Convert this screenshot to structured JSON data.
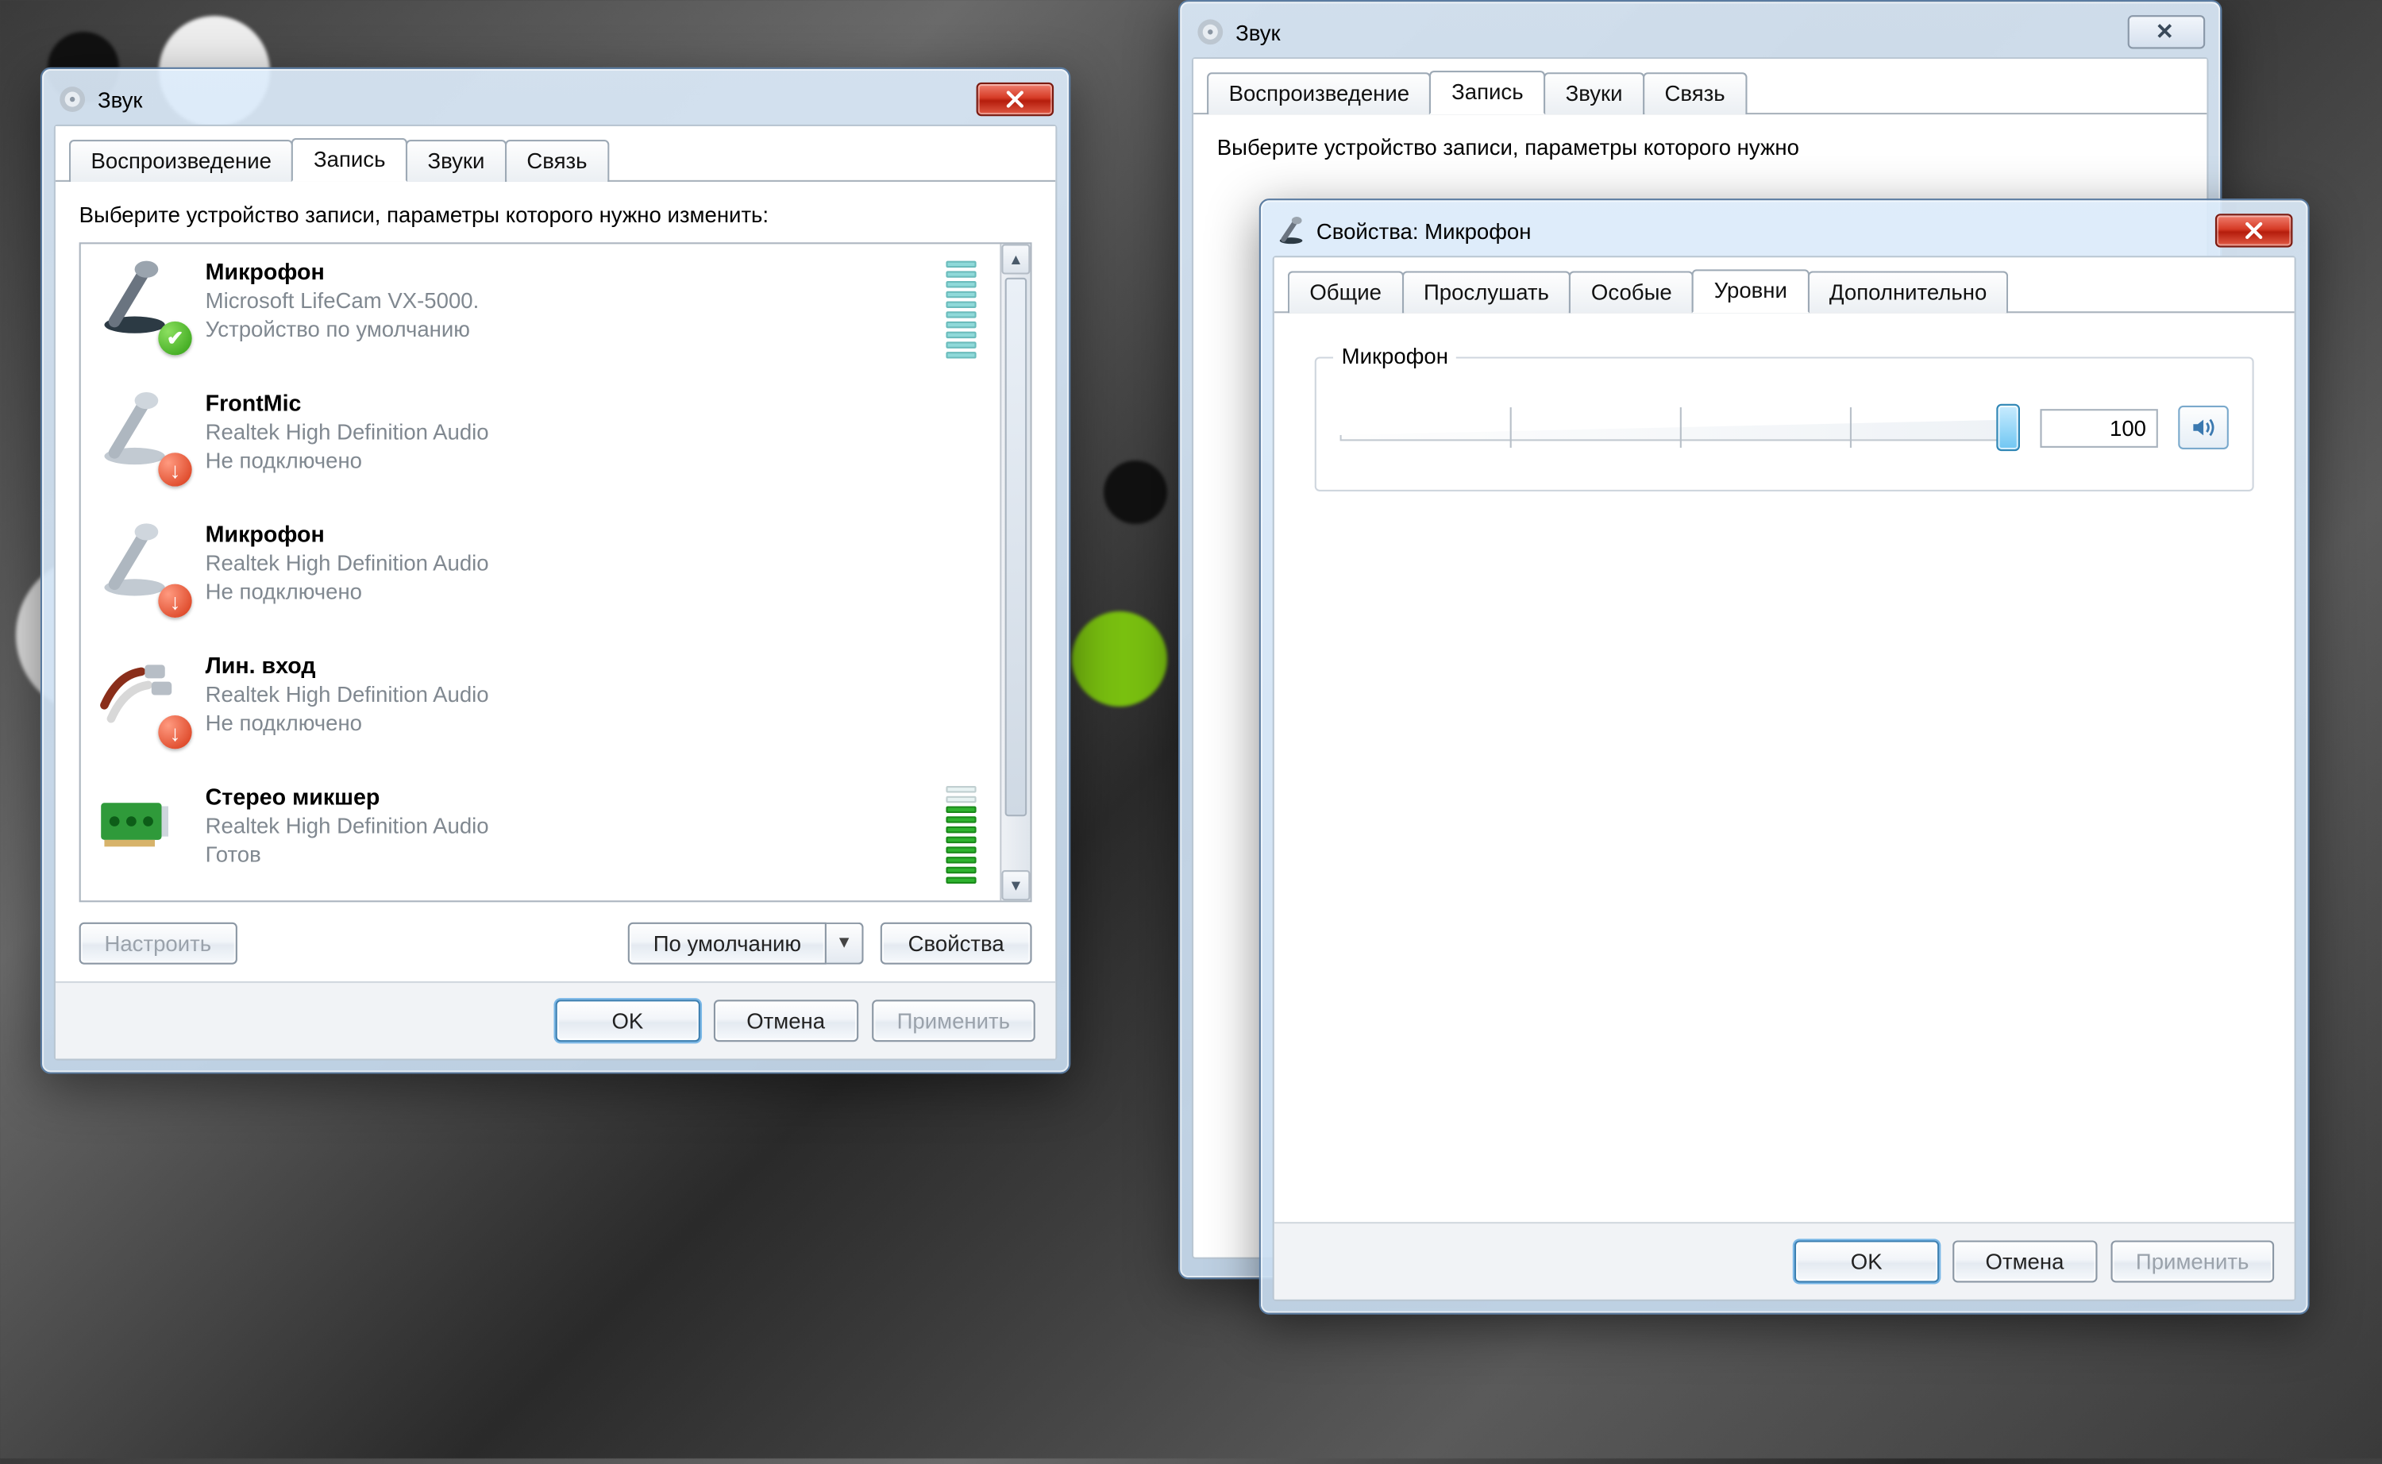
{
  "dialog_sound": {
    "title": "Звук",
    "tabs": [
      "Воспроизведение",
      "Запись",
      "Звуки",
      "Связь"
    ],
    "active_tab": "Запись",
    "prompt": "Выберите устройство записи, параметры которого нужно изменить:",
    "devices": [
      {
        "name": "Микрофон",
        "vendor": "Microsoft LifeCam VX-5000.",
        "status": "Устройство по умолчанию",
        "badge": "ok",
        "meter": "teal",
        "icon": "microphone"
      },
      {
        "name": "FrontMic",
        "vendor": "Realtek High Definition Audio",
        "status": "Не подключено",
        "badge": "down",
        "meter": "none",
        "icon": "microphone"
      },
      {
        "name": "Микрофон",
        "vendor": "Realtek High Definition Audio",
        "status": "Не подключено",
        "badge": "down",
        "meter": "none",
        "icon": "microphone"
      },
      {
        "name": "Лин. вход",
        "vendor": "Realtek High Definition Audio",
        "status": "Не подключено",
        "badge": "down",
        "meter": "none",
        "icon": "line-in"
      },
      {
        "name": "Стерео микшер",
        "vendor": "Realtek High Definition Audio",
        "status": "Готов",
        "badge": "none",
        "meter": "green",
        "icon": "sound-card"
      }
    ],
    "buttons": {
      "configure": "Настроить",
      "set_default": "По умолчанию",
      "properties": "Свойства"
    },
    "dlg_buttons": {
      "ok": "OK",
      "cancel": "Отмена",
      "apply": "Применить"
    }
  },
  "dialog_sound_back": {
    "title": "Звук",
    "tabs": [
      "Воспроизведение",
      "Запись",
      "Звуки",
      "Связь"
    ],
    "active_tab": "Запись",
    "prompt_partial": "Выберите устройство записи, параметры которого нужно"
  },
  "dialog_props": {
    "title": "Свойства: Микрофон",
    "tabs": [
      "Общие",
      "Прослушать",
      "Особые",
      "Уровни",
      "Дополнительно"
    ],
    "active_tab": "Уровни",
    "group_label": "Микрофон",
    "level_value": "100",
    "slider_percent": 100,
    "dlg_buttons": {
      "ok": "OK",
      "cancel": "Отмена",
      "apply": "Применить"
    }
  }
}
